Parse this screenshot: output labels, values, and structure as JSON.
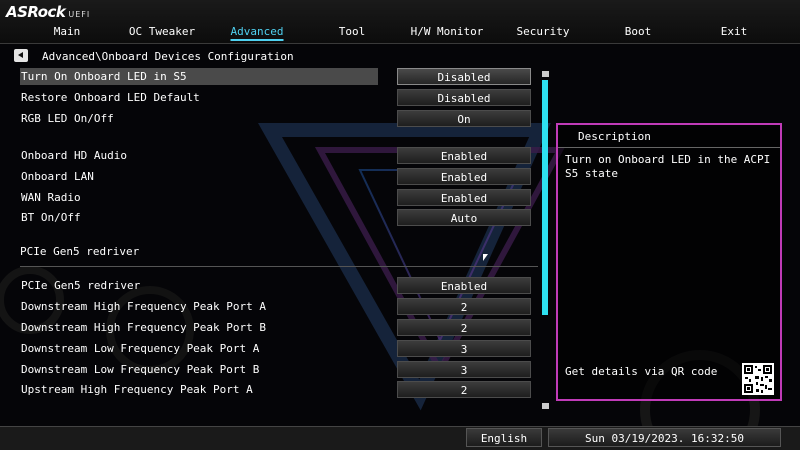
{
  "header": {
    "brand": "ASRock",
    "brand_suffix": "UEFI",
    "tabs": [
      {
        "label": "Main"
      },
      {
        "label": "OC Tweaker"
      },
      {
        "label": "Advanced",
        "active": true
      },
      {
        "label": "Tool"
      },
      {
        "label": "H/W Monitor"
      },
      {
        "label": "Security"
      },
      {
        "label": "Boot"
      },
      {
        "label": "Exit"
      }
    ]
  },
  "breadcrumb": "Advanced\\Onboard Devices Configuration",
  "settings": [
    {
      "label": "Turn On Onboard LED in S5",
      "value": "Disabled",
      "selected": true
    },
    {
      "label": "Restore Onboard LED Default",
      "value": "Disabled"
    },
    {
      "label": "RGB LED On/Off",
      "value": "On"
    },
    {
      "label": "Onboard HD Audio",
      "value": "Enabled"
    },
    {
      "label": "Onboard LAN",
      "value": "Enabled"
    },
    {
      "label": "WAN Radio",
      "value": "Enabled"
    },
    {
      "label": "BT On/Off",
      "value": "Auto"
    },
    {
      "label": "PCIe Gen5 redriver",
      "value": "Enabled"
    },
    {
      "label": "Downstream High Frequency Peak Port A",
      "value": "2"
    },
    {
      "label": "Downstream High Frequency Peak Port B",
      "value": "2"
    },
    {
      "label": "Downstream Low Frequency Peak Port A",
      "value": "3"
    },
    {
      "label": "Downstream Low Frequency Peak Port B",
      "value": "3"
    },
    {
      "label": "Upstream High Frequency Peak Port A",
      "value": "2"
    }
  ],
  "section_heading": "PCIe Gen5 redriver",
  "description": {
    "title": "Description",
    "text": "Turn on Onboard LED in the ACPI S5 state",
    "qr_label": "Get details via QR code"
  },
  "footer": {
    "language": "English",
    "datetime": "Sun 03/19/2023. 16:32:50"
  },
  "colors": {
    "accent": "#4fd0f0",
    "scrollbar": "#2ee0f0",
    "panel_border": "#c03bb8"
  },
  "icons": {
    "back": "chevron-left-icon",
    "qr": "qr-code-icon"
  }
}
